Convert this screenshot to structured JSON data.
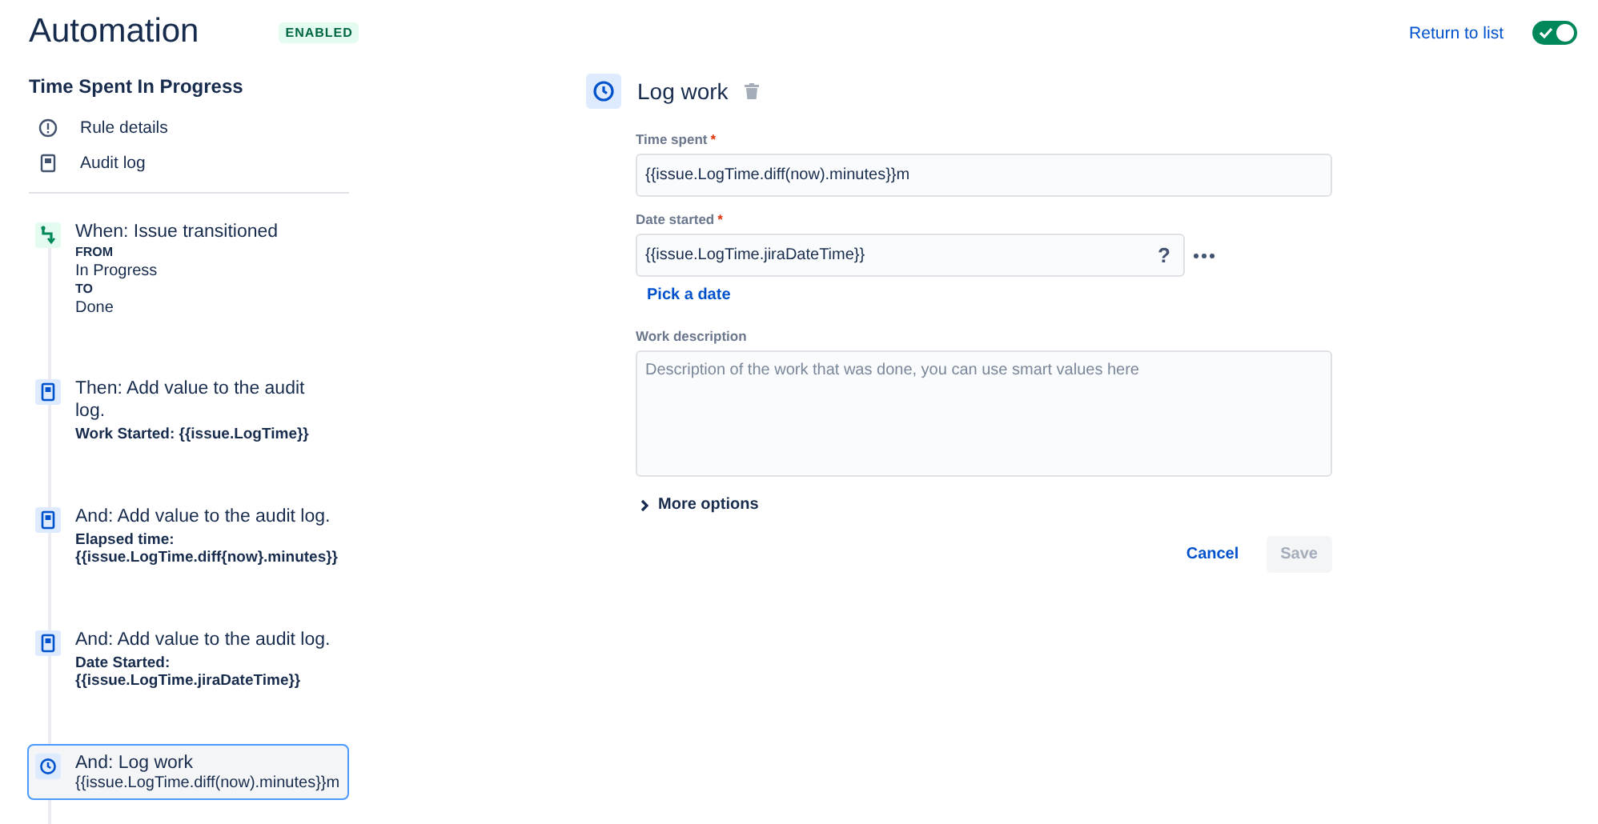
{
  "header": {
    "title": "Automation",
    "status_badge": "ENABLED",
    "return_link": "Return to list",
    "rule_enabled": true
  },
  "sidebar": {
    "rule_name": "Time Spent In Progress",
    "nav": [
      {
        "label": "Rule details",
        "kind": "info"
      },
      {
        "label": "Audit log",
        "kind": "log"
      }
    ],
    "steps": [
      {
        "kind": "trigger",
        "title": "When: Issue transitioned",
        "selected": false,
        "details": [
          {
            "text": "FROM",
            "kind": "label"
          },
          {
            "text": "In Progress",
            "kind": "plain"
          },
          {
            "text": "TO",
            "kind": "label"
          },
          {
            "text": "Done",
            "kind": "plain"
          }
        ]
      },
      {
        "kind": "audit",
        "title": "Then: Add value to the audit log.",
        "selected": false,
        "details": [
          {
            "text": "Work Started: {{issue.LogTime}}",
            "kind": "bold"
          }
        ]
      },
      {
        "kind": "audit",
        "title": "And: Add value to the audit log.",
        "selected": false,
        "details": [
          {
            "text": "Elapsed time: {{issue.LogTime.diff{now}.minutes}}",
            "kind": "bold"
          }
        ]
      },
      {
        "kind": "audit",
        "title": "And: Add value to the audit log.",
        "selected": false,
        "details": [
          {
            "text": "Date Started: {{issue.LogTime.jiraDateTime}}",
            "kind": "bold"
          }
        ]
      },
      {
        "kind": "worklog",
        "title": "And: Log work",
        "selected": true,
        "details": [
          {
            "text": "{{issue.LogTime.diff(now).minutes}}m",
            "kind": "plain"
          }
        ]
      }
    ]
  },
  "editor": {
    "title": "Log work",
    "fields": [
      {
        "kind": "text",
        "label": "Time spent",
        "required_mark": "*",
        "value": "{{issue.LogTime.diff(now).minutes}}m"
      },
      {
        "kind": "date",
        "label": "Date started",
        "required_mark": "*",
        "value": "{{issue.LogTime.jiraDateTime}}",
        "help": "?",
        "link": "Pick a date"
      },
      {
        "kind": "textarea",
        "label": "Work description",
        "placeholder": "Description of the work that was done, you can use smart values here"
      }
    ],
    "more_options": {
      "label": "More options",
      "expanded": false
    },
    "buttons": [
      {
        "label": "Cancel",
        "kind": "link",
        "disabled": false
      },
      {
        "label": "Save",
        "kind": "primary",
        "disabled": true
      }
    ]
  }
}
